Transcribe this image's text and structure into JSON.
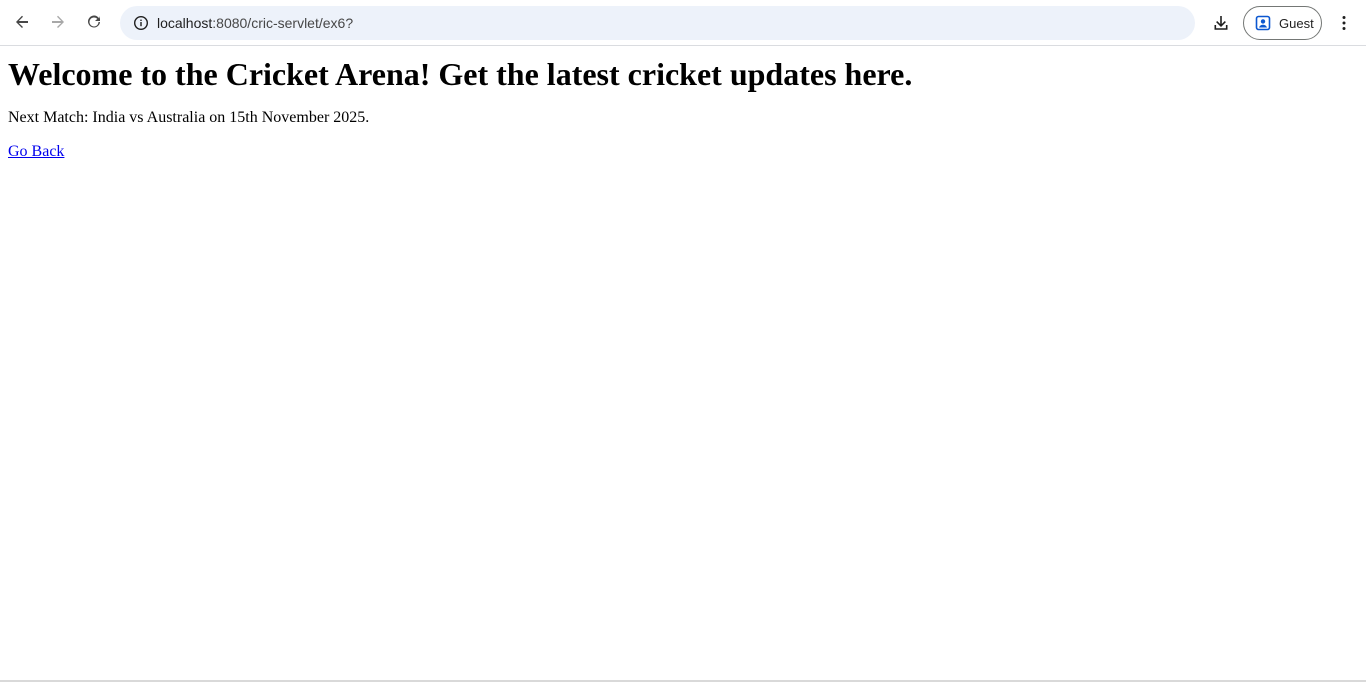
{
  "browser": {
    "url_host": "localhost",
    "url_path": ":8080/cric-servlet/ex6?",
    "profile_label": "Guest",
    "icons": {
      "back": "arrow-left-icon",
      "forward": "arrow-right-icon",
      "reload": "reload-icon",
      "site_info": "info-icon",
      "download": "download-icon",
      "profile": "person-icon",
      "menu": "more-vert-icon"
    },
    "accent_color": "#0b57d0"
  },
  "page": {
    "heading": "Welcome to the Cricket Arena! Get the latest cricket updates here.",
    "next_match": "Next Match: India vs Australia on 15th November 2025.",
    "back_link": "Go Back",
    "link_color": "#0000ee"
  }
}
